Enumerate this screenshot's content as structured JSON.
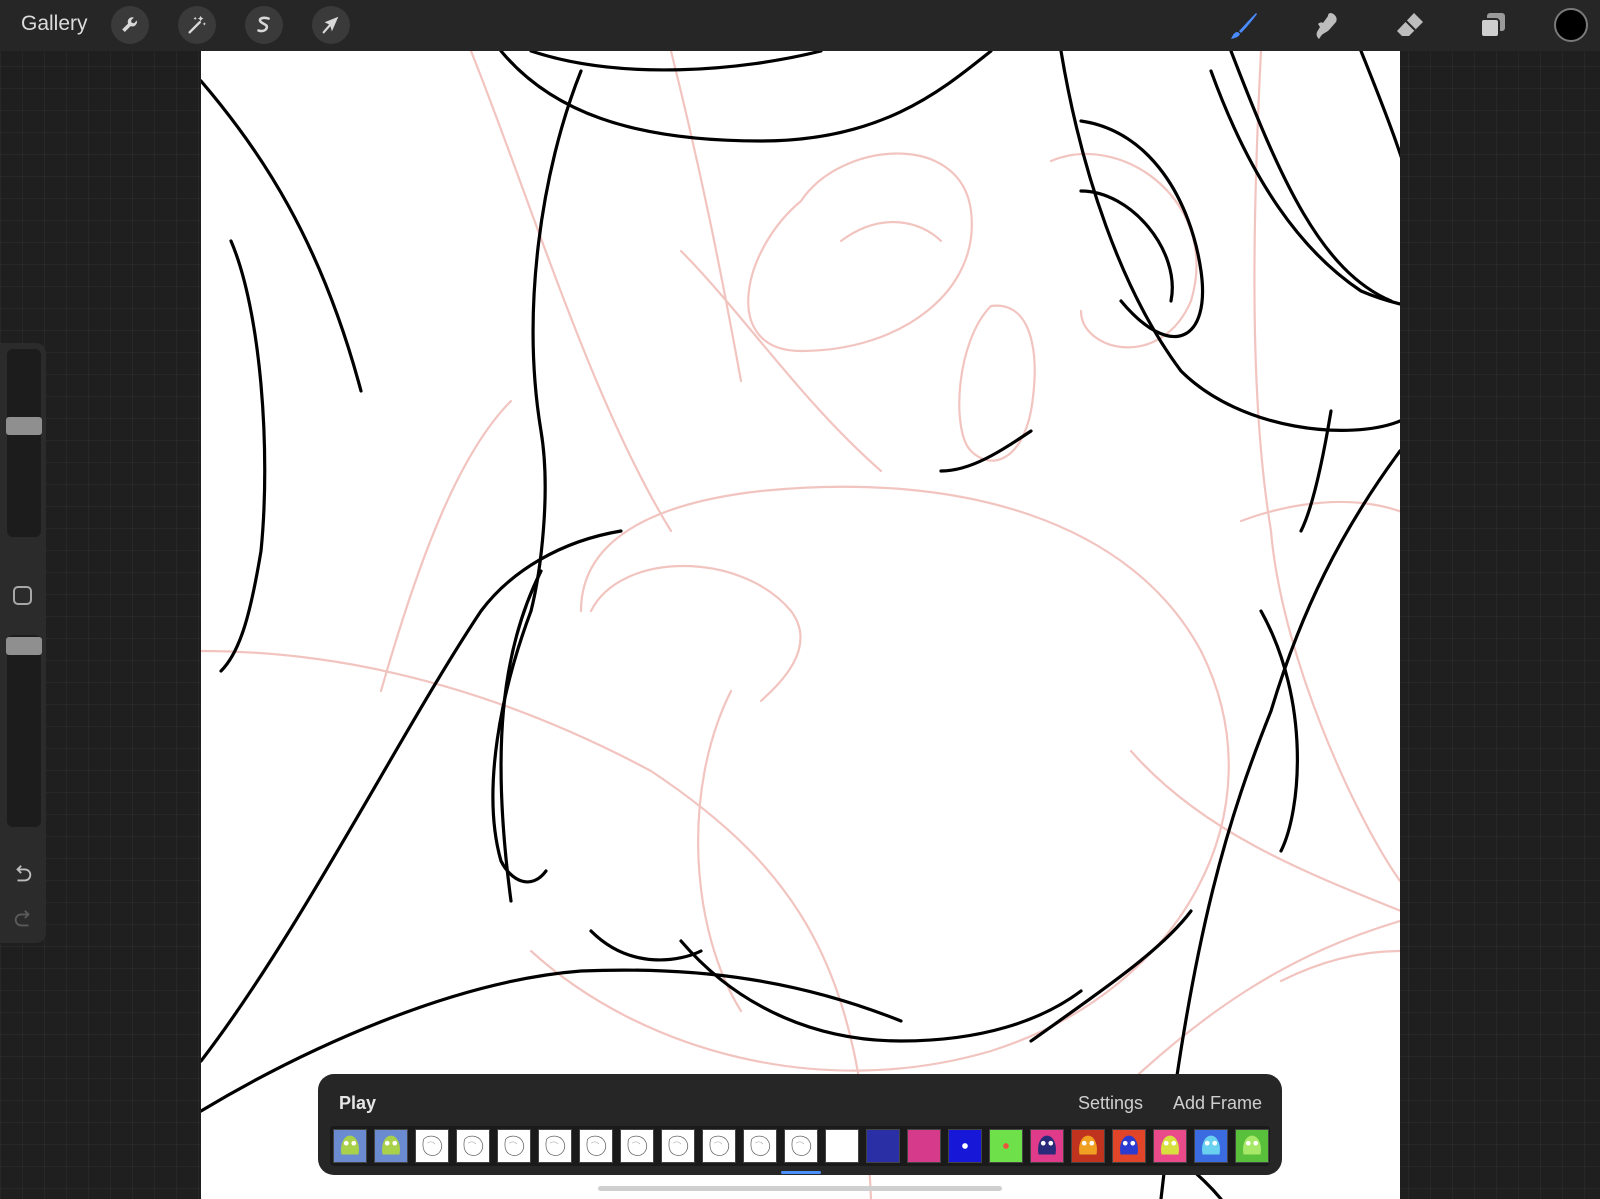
{
  "topbar": {
    "gallery_label": "Gallery",
    "left_tools": [
      "wrench-icon",
      "magic-wand-icon",
      "selection-icon",
      "transform-arrow-icon"
    ],
    "right_tools": [
      "brush-icon",
      "smudge-icon",
      "eraser-icon",
      "layers-icon"
    ],
    "active_tool": "brush-icon",
    "current_color": "#000000",
    "accent_color": "#4a8cff"
  },
  "sidebar": {
    "brush_size_level": 0.6,
    "opacity_level": 0.6,
    "icons": [
      "modify-square-icon",
      "undo-icon",
      "redo-icon"
    ]
  },
  "timeline": {
    "play_label": "Play",
    "settings_label": "Settings",
    "add_frame_label": "Add Frame",
    "selected_frame_index": 11,
    "frames": [
      {
        "kind": "art",
        "bg": "#6b8bd1",
        "fg": "#a9d04a"
      },
      {
        "kind": "art",
        "bg": "#6b8bd1",
        "fg": "#a9d04a"
      },
      {
        "kind": "sketch"
      },
      {
        "kind": "sketch"
      },
      {
        "kind": "sketch"
      },
      {
        "kind": "sketch"
      },
      {
        "kind": "sketch"
      },
      {
        "kind": "sketch"
      },
      {
        "kind": "sketch"
      },
      {
        "kind": "sketch"
      },
      {
        "kind": "sketch"
      },
      {
        "kind": "sketch"
      },
      {
        "kind": "blank",
        "bg": "#ffffff"
      },
      {
        "kind": "solid",
        "bg": "#2b2fa6"
      },
      {
        "kind": "solid",
        "bg": "#d63a8a"
      },
      {
        "kind": "dot",
        "bg": "#1717d8",
        "fg": "#ffffff"
      },
      {
        "kind": "dot",
        "bg": "#6ee04a",
        "fg": "#e8553a"
      },
      {
        "kind": "art",
        "bg": "#e03a8a",
        "fg": "#2a2a7a"
      },
      {
        "kind": "art",
        "bg": "#c0341f",
        "fg": "#f0a020"
      },
      {
        "kind": "art",
        "bg": "#e0452a",
        "fg": "#2b3bd0"
      },
      {
        "kind": "art",
        "bg": "#e84a8a",
        "fg": "#d8e040"
      },
      {
        "kind": "art",
        "bg": "#3b6be0",
        "fg": "#6ad0f0"
      },
      {
        "kind": "art",
        "bg": "#58c03a",
        "fg": "#a8e868"
      }
    ]
  }
}
